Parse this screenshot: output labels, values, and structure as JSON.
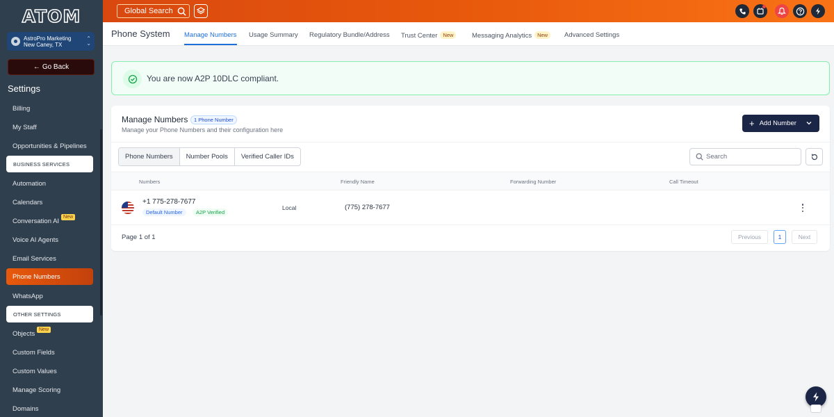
{
  "brand": {
    "logo_text": "ATOM"
  },
  "account": {
    "name": "AstroPro Marketing",
    "location": "New Caney, TX"
  },
  "sidebar": {
    "go_back": "Go Back",
    "title": "Settings",
    "items": [
      {
        "label": "Billing"
      },
      {
        "label": "My Staff"
      },
      {
        "label": "Opportunities & Pipelines"
      },
      {
        "label": "BUSINESS SERVICES"
      },
      {
        "label": "Automation"
      },
      {
        "label": "Calendars"
      },
      {
        "label": "Conversation AI",
        "badge": "New"
      },
      {
        "label": "Voice AI Agents"
      },
      {
        "label": "Email Services"
      },
      {
        "label": "Phone Numbers"
      },
      {
        "label": "WhatsApp"
      },
      {
        "label": "OTHER SETTINGS"
      },
      {
        "label": "Objects",
        "badge": "New"
      },
      {
        "label": "Custom Fields"
      },
      {
        "label": "Custom Values"
      },
      {
        "label": "Manage Scoring"
      },
      {
        "label": "Domains"
      }
    ]
  },
  "topbar": {
    "search_label": "Global Search",
    "icons": [
      "phone-icon",
      "megaphone-icon",
      "bell-icon",
      "help-icon",
      "assistant-icon"
    ]
  },
  "header": {
    "title": "Phone System",
    "tabs": [
      {
        "label": "Manage Numbers"
      },
      {
        "label": "Usage Summary"
      },
      {
        "label": "Regulatory Bundle/Address"
      },
      {
        "label": "Trust Center",
        "badge": "New"
      },
      {
        "label": "Messaging Analytics",
        "badge": "New"
      },
      {
        "label": "Advanced Settings"
      }
    ]
  },
  "alert": {
    "text": "You are now A2P 10DLC compliant."
  },
  "card": {
    "title": "Manage Numbers",
    "count_badge": "1 Phone Number",
    "subtitle": "Manage your Phone Numbers and their configuration here",
    "add_button": "Add Number",
    "subtabs": [
      "Phone Numbers",
      "Number Pools",
      "Verified Caller IDs"
    ],
    "search_placeholder": "Search",
    "columns": [
      "Numbers",
      "Friendly Name",
      "Forwarding Number",
      "Call Timeout"
    ],
    "rows": [
      {
        "number": "+1 775-278-7677",
        "badges": [
          "Default Number",
          "A2P Verified"
        ],
        "type": "Local",
        "friendly_name": "(775) 278-7677",
        "forwarding_number": "",
        "call_timeout": ""
      }
    ],
    "pagination": {
      "info": "Page 1 of 1",
      "previous": "Previous",
      "current": "1",
      "next": "Next"
    }
  },
  "colors": {
    "brand_orange": "#e8590c",
    "sidebar_bg": "#2f3f4e",
    "primary_blue": "#1d6ed8",
    "success_green": "#16a34a",
    "navy_button": "#1b2545"
  }
}
